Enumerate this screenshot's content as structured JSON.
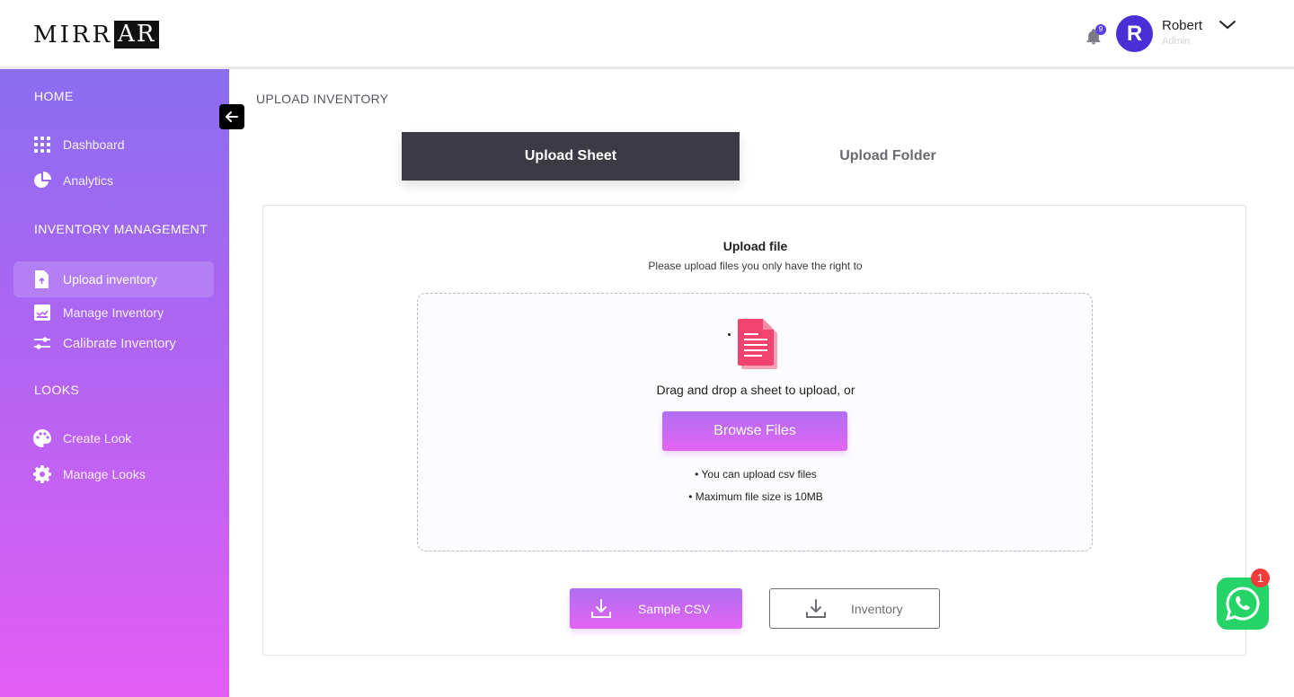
{
  "header": {
    "logo_left": "MIRR",
    "logo_right": "AR",
    "notification_count": "9",
    "user_initial": "R",
    "user_name": "Robert",
    "user_role": "Admin"
  },
  "sidebar": {
    "sections": [
      {
        "title": "HOME",
        "items": [
          {
            "label": "Dashboard",
            "icon": "grid-icon"
          },
          {
            "label": "Analytics",
            "icon": "pie-chart-icon"
          }
        ]
      },
      {
        "title": "INVENTORY MANAGEMENT",
        "items": [
          {
            "label": "Upload inventory",
            "icon": "file-upload-icon",
            "active": true
          },
          {
            "label": "Manage Inventory",
            "icon": "inventory-icon"
          },
          {
            "label": "Calibrate Inventory",
            "icon": "sliders-icon"
          }
        ]
      },
      {
        "title": "LOOKS",
        "items": [
          {
            "label": "Create Look",
            "icon": "palette-icon"
          },
          {
            "label": "Manage Looks",
            "icon": "gear-icon"
          }
        ]
      }
    ]
  },
  "main": {
    "page_title": "UPLOAD INVENTORY",
    "tabs": [
      {
        "label": "Upload Sheet",
        "active": true
      },
      {
        "label": "Upload Folder",
        "active": false
      }
    ],
    "upload": {
      "title": "Upload file",
      "subtitle": "Please upload files you only have the right to",
      "drag_text": "Drag and drop a sheet to upload, or",
      "browse_label": "Browse Files",
      "hints": [
        "• You can upload csv files",
        "• Maximum file size is 10MB"
      ]
    },
    "downloads": {
      "sample_label": "Sample CSV",
      "inventory_label": "Inventory"
    }
  },
  "whatsapp": {
    "badge": "1"
  },
  "colors": {
    "sidebar_top": "#8a6ef0",
    "sidebar_bottom": "#e35ef5",
    "accent": "#b06ef2",
    "active_tab": "#3c3b45",
    "avatar": "#4a2fd6",
    "file_icon": "#f0446f",
    "whatsapp": "#25d366"
  }
}
